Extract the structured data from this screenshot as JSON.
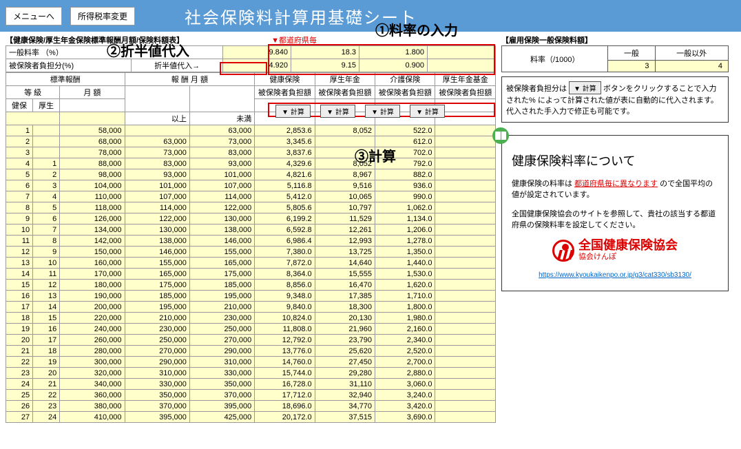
{
  "header": {
    "menu_btn": "メニューへ",
    "tax_btn": "所得税率変更",
    "title": "社会保険料計算用基礎シート"
  },
  "annotations": {
    "a1": "①料率の入力",
    "a2": "②折半値代入",
    "a3": "③計算"
  },
  "left": {
    "section_title": "【健康保険/厚生年金保険標準報酬月額/保険料額表】",
    "pref_label": "▼都道府県毎",
    "general_rate_label": "一般料率 （%）",
    "general_rates": [
      "9.840",
      "18.3",
      "1.800",
      ""
    ],
    "insured_share_label": "被保険者負担分(%)",
    "half_substitute_btn": "折半値代入→",
    "insured_shares": [
      "4.920",
      "9.15",
      "0.900",
      ""
    ],
    "group_headers": {
      "std_pay": "標準報酬",
      "monthly_pay": "報    酬    月    額",
      "health": "健康保険",
      "pension": "厚生年金",
      "care": "介護保険",
      "fund": "厚生年金基金"
    },
    "sub_headers": {
      "grade": "等    級",
      "monthly": "月  額",
      "ijou": "以上",
      "miman": "未満",
      "share": "被保険者負担額",
      "kenpo": "健保",
      "kousei": "厚生"
    },
    "calc_btn": "▼ 計算",
    "rows": [
      {
        "n": 1,
        "k": "",
        "m": "58,000",
        "lo": "",
        "hi": "63,000",
        "h": "2,853.6",
        "p": "8,052",
        "c": "522.0"
      },
      {
        "n": 2,
        "k": "",
        "m": "68,000",
        "lo": "63,000",
        "hi": "73,000",
        "h": "3,345.6",
        "p": "",
        "c": "612.0"
      },
      {
        "n": 3,
        "k": "",
        "m": "78,000",
        "lo": "73,000",
        "hi": "83,000",
        "h": "3,837.6",
        "p": "",
        "c": "702.0"
      },
      {
        "n": 4,
        "k": "1",
        "m": "88,000",
        "lo": "83,000",
        "hi": "93,000",
        "h": "4,329.6",
        "p": "8,052",
        "c": "792.0"
      },
      {
        "n": 5,
        "k": "2",
        "m": "98,000",
        "lo": "93,000",
        "hi": "101,000",
        "h": "4,821.6",
        "p": "8,967",
        "c": "882.0"
      },
      {
        "n": 6,
        "k": "3",
        "m": "104,000",
        "lo": "101,000",
        "hi": "107,000",
        "h": "5,116.8",
        "p": "9,516",
        "c": "936.0"
      },
      {
        "n": 7,
        "k": "4",
        "m": "110,000",
        "lo": "107,000",
        "hi": "114,000",
        "h": "5,412.0",
        "p": "10,065",
        "c": "990.0"
      },
      {
        "n": 8,
        "k": "5",
        "m": "118,000",
        "lo": "114,000",
        "hi": "122,000",
        "h": "5,805.6",
        "p": "10,797",
        "c": "1,062.0"
      },
      {
        "n": 9,
        "k": "6",
        "m": "126,000",
        "lo": "122,000",
        "hi": "130,000",
        "h": "6,199.2",
        "p": "11,529",
        "c": "1,134.0"
      },
      {
        "n": 10,
        "k": "7",
        "m": "134,000",
        "lo": "130,000",
        "hi": "138,000",
        "h": "6,592.8",
        "p": "12,261",
        "c": "1,206.0"
      },
      {
        "n": 11,
        "k": "8",
        "m": "142,000",
        "lo": "138,000",
        "hi": "146,000",
        "h": "6,986.4",
        "p": "12,993",
        "c": "1,278.0"
      },
      {
        "n": 12,
        "k": "9",
        "m": "150,000",
        "lo": "146,000",
        "hi": "155,000",
        "h": "7,380.0",
        "p": "13,725",
        "c": "1,350.0"
      },
      {
        "n": 13,
        "k": "10",
        "m": "160,000",
        "lo": "155,000",
        "hi": "165,000",
        "h": "7,872.0",
        "p": "14,640",
        "c": "1,440.0"
      },
      {
        "n": 14,
        "k": "11",
        "m": "170,000",
        "lo": "165,000",
        "hi": "175,000",
        "h": "8,364.0",
        "p": "15,555",
        "c": "1,530.0"
      },
      {
        "n": 15,
        "k": "12",
        "m": "180,000",
        "lo": "175,000",
        "hi": "185,000",
        "h": "8,856.0",
        "p": "16,470",
        "c": "1,620.0"
      },
      {
        "n": 16,
        "k": "13",
        "m": "190,000",
        "lo": "185,000",
        "hi": "195,000",
        "h": "9,348.0",
        "p": "17,385",
        "c": "1,710.0"
      },
      {
        "n": 17,
        "k": "14",
        "m": "200,000",
        "lo": "195,000",
        "hi": "210,000",
        "h": "9,840.0",
        "p": "18,300",
        "c": "1,800.0"
      },
      {
        "n": 18,
        "k": "15",
        "m": "220,000",
        "lo": "210,000",
        "hi": "230,000",
        "h": "10,824.0",
        "p": "20,130",
        "c": "1,980.0"
      },
      {
        "n": 19,
        "k": "16",
        "m": "240,000",
        "lo": "230,000",
        "hi": "250,000",
        "h": "11,808.0",
        "p": "21,960",
        "c": "2,160.0"
      },
      {
        "n": 20,
        "k": "17",
        "m": "260,000",
        "lo": "250,000",
        "hi": "270,000",
        "h": "12,792.0",
        "p": "23,790",
        "c": "2,340.0"
      },
      {
        "n": 21,
        "k": "18",
        "m": "280,000",
        "lo": "270,000",
        "hi": "290,000",
        "h": "13,776.0",
        "p": "25,620",
        "c": "2,520.0"
      },
      {
        "n": 22,
        "k": "19",
        "m": "300,000",
        "lo": "290,000",
        "hi": "310,000",
        "h": "14,760.0",
        "p": "27,450",
        "c": "2,700.0"
      },
      {
        "n": 23,
        "k": "20",
        "m": "320,000",
        "lo": "310,000",
        "hi": "330,000",
        "h": "15,744.0",
        "p": "29,280",
        "c": "2,880.0"
      },
      {
        "n": 24,
        "k": "21",
        "m": "340,000",
        "lo": "330,000",
        "hi": "350,000",
        "h": "16,728.0",
        "p": "31,110",
        "c": "3,060.0"
      },
      {
        "n": 25,
        "k": "22",
        "m": "360,000",
        "lo": "350,000",
        "hi": "370,000",
        "h": "17,712.0",
        "p": "32,940",
        "c": "3,240.0"
      },
      {
        "n": 26,
        "k": "23",
        "m": "380,000",
        "lo": "370,000",
        "hi": "395,000",
        "h": "18,696.0",
        "p": "34,770",
        "c": "3,420.0"
      },
      {
        "n": 27,
        "k": "24",
        "m": "410,000",
        "lo": "395,000",
        "hi": "425,000",
        "h": "20,172.0",
        "p": "37,515",
        "c": "3,690.0"
      }
    ]
  },
  "right": {
    "emp_ins_title": "【雇用保険一般保険料額】",
    "rate_label": "料率（/1000）",
    "general": "一般",
    "non_general": "一般以外",
    "rate_general": "3",
    "rate_non_general": "4",
    "desc_prefix": "被保険者負担分は",
    "desc_btn": "▼ 計算",
    "desc_suffix": "ボタンをクリックすることで入力された% によって計算された値が表に自動的に代入されます。代入された手入力で修正も可能です。",
    "info_title": "健康保険料率について",
    "info_p1a": "健康保険の料率は",
    "info_p1b": "都道府県毎に異なります",
    "info_p1c": "ので全国平均の値が設定されています。",
    "info_p2": "全国健康保険協会のサイトを参照して、貴社の該当する都道府県の保険料率を設定してください。",
    "kenpo_name": "全国健康保険協会",
    "kenpo_sub": "協会けんぽ",
    "kenpo_url": "https://www.kyoukaikenpo.or.jp/g3/cat330/sb3130/"
  }
}
